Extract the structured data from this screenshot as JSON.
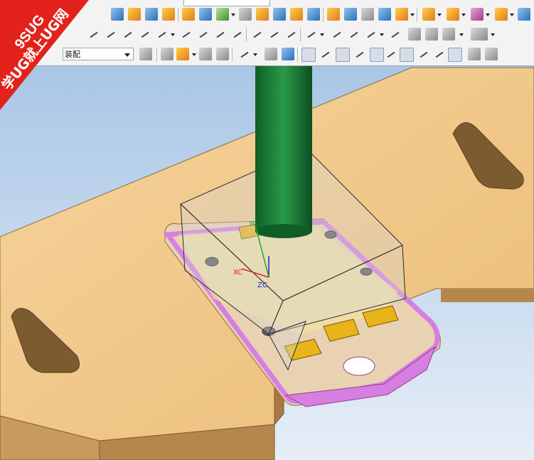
{
  "toolbar": {
    "layer_combo_value": "装配",
    "row1_icons": [
      "sheet-icon",
      "extrude-icon",
      "revolve-icon",
      "hole-icon",
      "boss-icon",
      "pocket-icon",
      "pad-icon",
      "emboss-icon",
      "blend-icon",
      "chamfer-icon",
      "shell-icon",
      "draft-icon",
      "pattern-icon",
      "mirror-icon",
      "trim-body-icon",
      "split-body-icon",
      "unite-icon",
      "subtract-icon",
      "intersect-icon",
      "offset-face-icon",
      "move-face-icon",
      "sew-icon",
      "replace-face-icon",
      "patch-icon"
    ],
    "row2_icons": [
      "sketch-icon",
      "arc-icon",
      "rectangle-icon",
      "studio-spline-icon",
      "point-icon",
      "circle-icon",
      "fillet-sketch-icon",
      "offset-curve-icon",
      "project-curve-icon",
      "intersection-curve-icon",
      "bridge-curve-icon",
      "helix-icon",
      "text-icon",
      "law-curve-icon",
      "trim-curve-icon",
      "divide-curve-icon",
      "extend-icon",
      "analysis-icon",
      "measure-icon",
      "info-icon"
    ],
    "row3_icons": [
      "wcs-icon",
      "point-constructor-icon",
      "snap-icon",
      "selection-box-icon",
      "shaded-icon",
      "wireframe-icon",
      "end-point-snap-icon",
      "mid-point-snap-icon",
      "control-point-snap-icon",
      "intersection-snap-icon",
      "center-snap-icon",
      "quadrant-snap-icon",
      "on-curve-snap-icon",
      "tangent-snap-icon",
      "grid-icon"
    ]
  },
  "watermark": {
    "brand": "9SUG",
    "slogan": "学UG就上UG网"
  },
  "triad": {
    "xc": "XC",
    "yc": "YC",
    "zc": "ZC"
  },
  "colors": {
    "plate": "#f1c888",
    "plate_side": "#c89a5f",
    "part": "#d77fe0",
    "tool": "#1f7f3a",
    "banner": "#e3231b",
    "background": "#cfe0f2"
  }
}
